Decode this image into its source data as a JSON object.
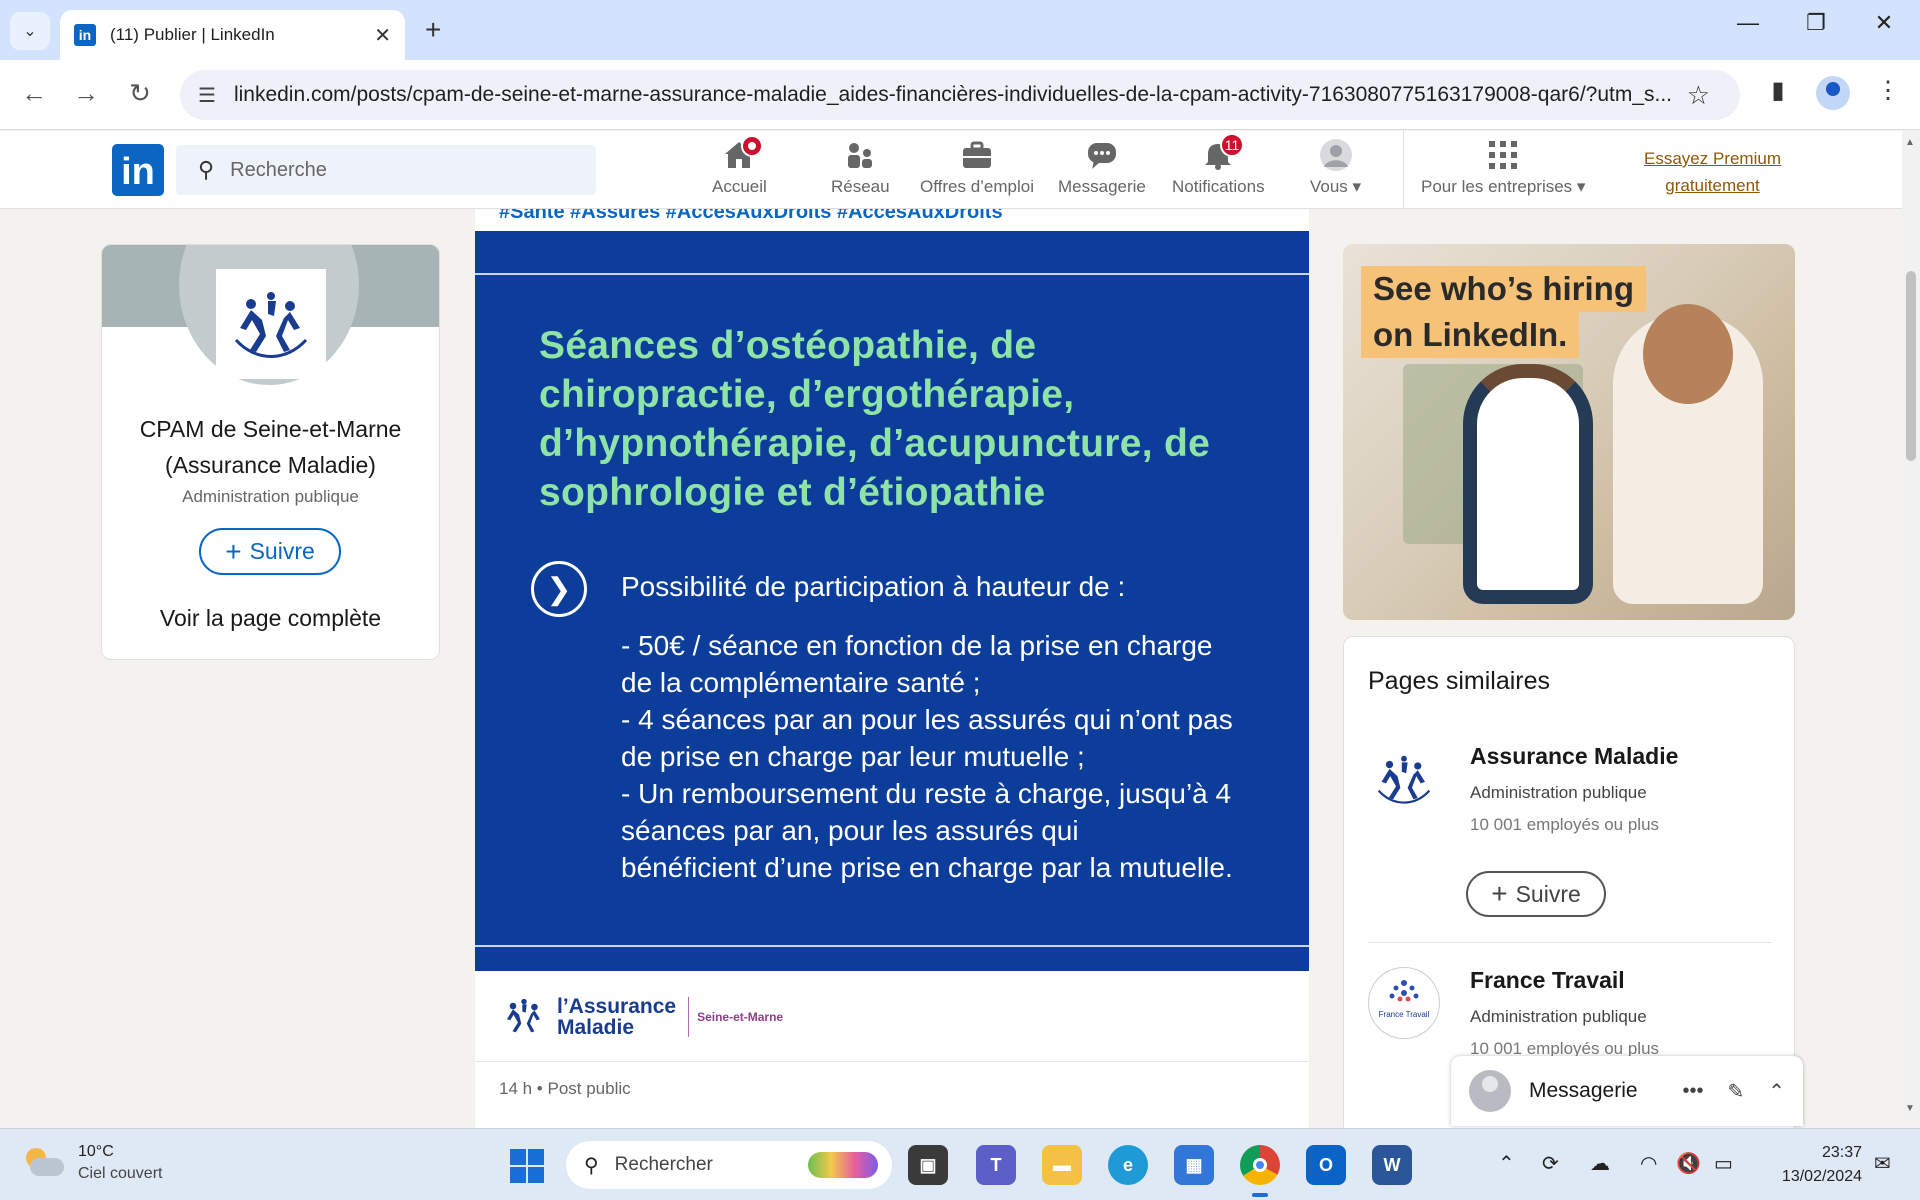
{
  "browser": {
    "tab_title": "(11) Publier | LinkedIn",
    "url": "linkedin.com/posts/cpam-de-seine-et-marne-assurance-maladie_aides-financières-individuelles-de-la-cpam-activity-7163080775163179008-qar6/?utm_s..."
  },
  "linkedin": {
    "search_placeholder": "Recherche",
    "nav": [
      {
        "label": "Accueil",
        "icon": "home-icon"
      },
      {
        "label": "Réseau",
        "icon": "network-icon"
      },
      {
        "label": "Offres d’emploi",
        "icon": "briefcase-icon"
      },
      {
        "label": "Messagerie",
        "icon": "chat-icon"
      },
      {
        "label": "Notifications",
        "icon": "bell-icon",
        "badge": "11"
      },
      {
        "label": "Vous",
        "icon": "avatar-icon"
      },
      {
        "label": "Pour les entreprises",
        "icon": "grid-icon"
      }
    ],
    "premium": "Essayez Premium gratuitement",
    "accent": "#0a66c2"
  },
  "left_card": {
    "name": "CPAM de Seine-et-Marne (Assurance Maladie)",
    "kind": "Administration publique",
    "follow": "Suivre",
    "full_page": "Voir la page complète"
  },
  "post": {
    "tags": "#Santé #Assurés #AccesAuxDroits #AccesAuxDroits",
    "heading": "Séances d’ostéopathie, de chiropractie, d’ergothérapie, d’hypnothérapie, d’acupuncture, de sophrologie et d’étiopathie",
    "intro": "Possibilité de participation à hauteur de :",
    "body_lines": [
      "- 50€ / séance en fonction de la prise en charge",
      "de la complémentaire santé ;",
      "- 4 séances par an pour les assurés qui n’ont pas",
      "de prise en charge par leur mutuelle ;",
      "- Un remboursement du reste à charge, jusqu’à 4",
      "séances par an, pour les assurés qui",
      "bénéficient d’une prise en charge par la mutuelle."
    ],
    "brand_name_1": "l’Assurance",
    "brand_name_2": "Maladie",
    "brand_dept": "Seine-et-Marne",
    "meta": "14 h • Post public",
    "box_color": "#0d3d9a",
    "heading_color": "#8ee3a6"
  },
  "ad": {
    "line1": "See who’s hiring",
    "line2": "on LinkedIn."
  },
  "similar": {
    "title": "Pages similaires",
    "items": [
      {
        "name": "Assurance Maladie",
        "kind": "Administration publique",
        "count": "10 001 employés ou plus",
        "follow": "Suivre"
      },
      {
        "name": "France Travail",
        "kind": "Administration publique",
        "count": "10 001 employés ou plus",
        "logo_text": "France Travail"
      }
    ]
  },
  "messaging": {
    "label": "Messagerie"
  },
  "taskbar": {
    "temp": "10°C",
    "weather": "Ciel couvert",
    "search": "Rechercher",
    "time": "23:37",
    "date": "13/02/2024"
  }
}
